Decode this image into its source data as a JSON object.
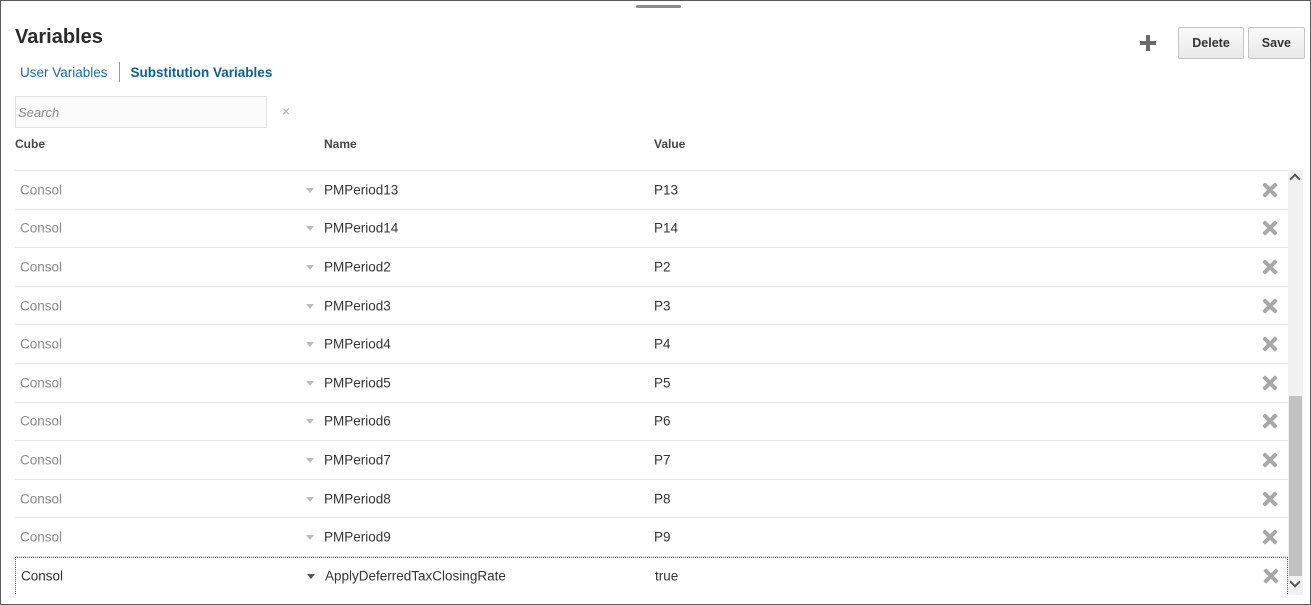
{
  "page": {
    "title": "Variables"
  },
  "tabs": [
    {
      "label": "User Variables",
      "active": false
    },
    {
      "label": "Substitution Variables",
      "active": true
    }
  ],
  "toolbar": {
    "add_icon": "plus-icon",
    "delete_label": "Delete",
    "save_label": "Save"
  },
  "search": {
    "placeholder": "Search",
    "value": "",
    "clear_glyph": "×"
  },
  "columns": {
    "cube": "Cube",
    "name": "Name",
    "value": "Value"
  },
  "rows": [
    {
      "cube": "Consol",
      "name": "PMPeriod13",
      "value": "P13"
    },
    {
      "cube": "Consol",
      "name": "PMPeriod14",
      "value": "P14"
    },
    {
      "cube": "Consol",
      "name": "PMPeriod2",
      "value": "P2"
    },
    {
      "cube": "Consol",
      "name": "PMPeriod3",
      "value": "P3"
    },
    {
      "cube": "Consol",
      "name": "PMPeriod4",
      "value": "P4"
    },
    {
      "cube": "Consol",
      "name": "PMPeriod5",
      "value": "P5"
    },
    {
      "cube": "Consol",
      "name": "PMPeriod6",
      "value": "P6"
    },
    {
      "cube": "Consol",
      "name": "PMPeriod7",
      "value": "P7"
    },
    {
      "cube": "Consol",
      "name": "PMPeriod8",
      "value": "P8"
    },
    {
      "cube": "Consol",
      "name": "PMPeriod9",
      "value": "P9"
    },
    {
      "cube": "Consol",
      "name": "ApplyDeferredTaxClosingRate",
      "value": "true",
      "selected": true
    }
  ],
  "colors": {
    "link": "#1a6aa8",
    "active_tab": "#0d5f99",
    "text": "#333333",
    "muted": "#8a8a8a"
  }
}
